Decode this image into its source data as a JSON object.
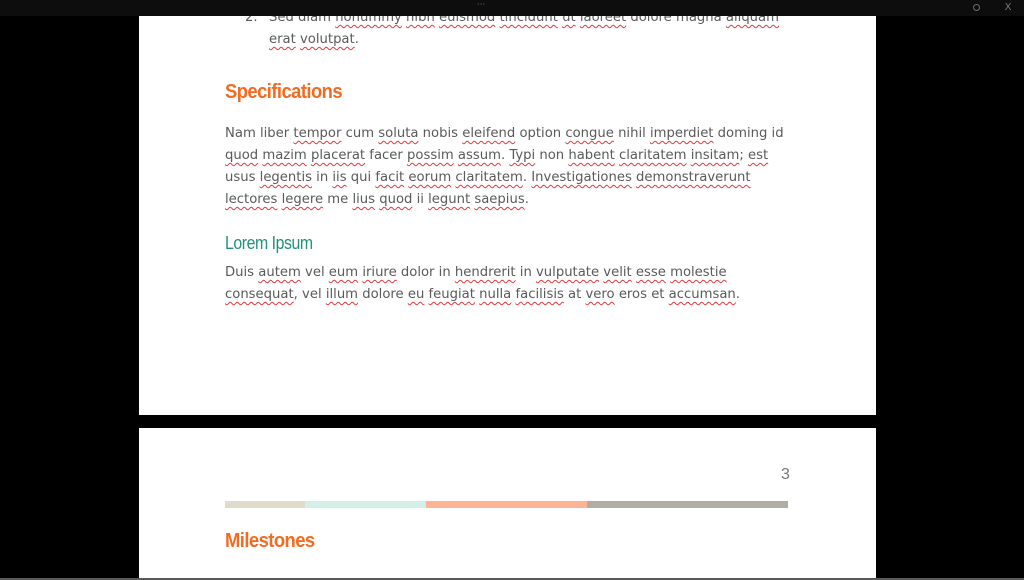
{
  "window": {
    "grip_label": "···",
    "restore_icon": "restore-icon",
    "close_label": "X"
  },
  "theme": {
    "heading_orange": "#f26b21",
    "heading_teal": "#23907b",
    "body_text": "#5a5a5a",
    "spell_underline": "#e2373f",
    "background": "#000000",
    "page": "#ffffff"
  },
  "page1": {
    "list_item": {
      "number": "2.",
      "words": [
        {
          "t": "Sed diam ",
          "s": false
        },
        {
          "t": "nonummy",
          "s": true
        },
        {
          "t": " ",
          "s": false
        },
        {
          "t": "nibh",
          "s": true
        },
        {
          "t": " ",
          "s": false
        },
        {
          "t": "euismod",
          "s": true
        },
        {
          "t": " ",
          "s": false
        },
        {
          "t": "tincidunt",
          "s": true
        },
        {
          "t": " ",
          "s": false
        },
        {
          "t": "ut",
          "s": true
        },
        {
          "t": " ",
          "s": false
        },
        {
          "t": "laoreet",
          "s": true
        },
        {
          "t": " dolore magna ",
          "s": false
        },
        {
          "t": "aliquam",
          "s": true
        },
        {
          "t": " ",
          "s": false
        },
        {
          "t": "erat",
          "s": true
        },
        {
          "t": " ",
          "s": false
        },
        {
          "t": "volutpat",
          "s": true
        },
        {
          "t": ".",
          "s": false
        }
      ]
    },
    "specifications": {
      "heading": "Specifications",
      "words": [
        {
          "t": "Nam liber ",
          "s": false
        },
        {
          "t": "tempor",
          "s": true
        },
        {
          "t": " cum ",
          "s": false
        },
        {
          "t": "soluta",
          "s": true
        },
        {
          "t": " nobis ",
          "s": false
        },
        {
          "t": "eleifend",
          "s": true
        },
        {
          "t": " option ",
          "s": false
        },
        {
          "t": "congue",
          "s": true
        },
        {
          "t": " nihil ",
          "s": false
        },
        {
          "t": "imperdiet",
          "s": true
        },
        {
          "t": " doming id ",
          "s": false
        },
        {
          "t": "quod",
          "s": true
        },
        {
          "t": " ",
          "s": false
        },
        {
          "t": "mazim",
          "s": true
        },
        {
          "t": " ",
          "s": false
        },
        {
          "t": "placerat",
          "s": true
        },
        {
          "t": " facer ",
          "s": false
        },
        {
          "t": "possim",
          "s": true
        },
        {
          "t": " ",
          "s": false
        },
        {
          "t": "assum",
          "s": true
        },
        {
          "t": ". ",
          "s": false
        },
        {
          "t": "Typi",
          "s": true
        },
        {
          "t": " non ",
          "s": false
        },
        {
          "t": "habent",
          "s": true
        },
        {
          "t": " ",
          "s": false
        },
        {
          "t": "claritatem",
          "s": true
        },
        {
          "t": " ",
          "s": false
        },
        {
          "t": "insitam",
          "s": true
        },
        {
          "t": "; ",
          "s": false
        },
        {
          "t": "est",
          "s": true
        },
        {
          "t": " usus ",
          "s": false
        },
        {
          "t": "legentis",
          "s": true
        },
        {
          "t": " in ",
          "s": false
        },
        {
          "t": "iis",
          "s": true
        },
        {
          "t": " qui ",
          "s": false
        },
        {
          "t": "facit",
          "s": true
        },
        {
          "t": " ",
          "s": false
        },
        {
          "t": "eorum",
          "s": true
        },
        {
          "t": " ",
          "s": false
        },
        {
          "t": "claritatem",
          "s": true
        },
        {
          "t": ". ",
          "s": false
        },
        {
          "t": "Investigationes",
          "s": true
        },
        {
          "t": " ",
          "s": false
        },
        {
          "t": "demonstraverunt",
          "s": true
        },
        {
          "t": " ",
          "s": false
        },
        {
          "t": "lectores",
          "s": true
        },
        {
          "t": " ",
          "s": false
        },
        {
          "t": "legere",
          "s": true
        },
        {
          "t": " me ",
          "s": false
        },
        {
          "t": "lius",
          "s": true
        },
        {
          "t": " ",
          "s": false
        },
        {
          "t": "quod",
          "s": true
        },
        {
          "t": " ii ",
          "s": false
        },
        {
          "t": "legunt",
          "s": true
        },
        {
          "t": " ",
          "s": false
        },
        {
          "t": "saepius",
          "s": true
        },
        {
          "t": ".",
          "s": false
        }
      ]
    },
    "lorem": {
      "heading": "Lorem Ipsum",
      "words": [
        {
          "t": "Duis ",
          "s": false
        },
        {
          "t": "autem",
          "s": true
        },
        {
          "t": " vel ",
          "s": false
        },
        {
          "t": "eum",
          "s": true
        },
        {
          "t": " ",
          "s": false
        },
        {
          "t": "iriure",
          "s": true
        },
        {
          "t": " dolor in ",
          "s": false
        },
        {
          "t": "hendrerit",
          "s": true
        },
        {
          "t": " in ",
          "s": false
        },
        {
          "t": "vulputate",
          "s": true
        },
        {
          "t": " ",
          "s": false
        },
        {
          "t": "velit",
          "s": true
        },
        {
          "t": " ",
          "s": false
        },
        {
          "t": "esse",
          "s": true
        },
        {
          "t": " ",
          "s": false
        },
        {
          "t": "molestie",
          "s": true
        },
        {
          "t": " ",
          "s": false
        },
        {
          "t": "consequat",
          "s": true
        },
        {
          "t": ", vel ",
          "s": false
        },
        {
          "t": "illum",
          "s": true
        },
        {
          "t": " dolore ",
          "s": false
        },
        {
          "t": "eu",
          "s": true
        },
        {
          "t": " ",
          "s": false
        },
        {
          "t": "feugiat",
          "s": true
        },
        {
          "t": " ",
          "s": false
        },
        {
          "t": "nulla",
          "s": true
        },
        {
          "t": " ",
          "s": false
        },
        {
          "t": "facilisis",
          "s": true
        },
        {
          "t": " at ",
          "s": false
        },
        {
          "t": "vero",
          "s": true
        },
        {
          "t": " eros et ",
          "s": false
        },
        {
          "t": "accumsan",
          "s": true
        },
        {
          "t": ".",
          "s": false
        }
      ]
    }
  },
  "page2": {
    "page_number": "3",
    "colorbar": [
      {
        "color": "#e0dccb",
        "weight": 80
      },
      {
        "color": "#d2f0e8",
        "weight": 121
      },
      {
        "color": "#ffb396",
        "weight": 161
      },
      {
        "color": "#b0aea4",
        "weight": 201
      }
    ],
    "heading": "Milestones"
  }
}
